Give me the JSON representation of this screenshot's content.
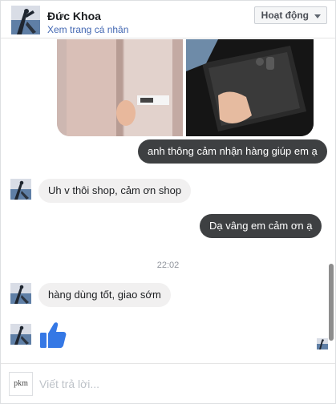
{
  "header": {
    "name": "Đức Khoa",
    "profile_link": "Xem trang cá nhân",
    "status_button": "Hoạt động"
  },
  "messages": {
    "outgoing_1": "anh thông cảm nhận hàng giúp em ạ",
    "incoming_1": "Uh v thôi shop, cảm ơn shop",
    "outgoing_2": "Dạ vâng em cảm ơn ạ",
    "timestamp": "22:02",
    "incoming_2": "hàng dùng tốt, giao sớm"
  },
  "composer": {
    "self_avatar_text": "pkm",
    "placeholder": "Viết trả lời..."
  },
  "icons": {
    "like": "thumbs-up-icon",
    "status_caret": "chevron-down-icon"
  },
  "colors": {
    "outgoing_bubble": "#3e4042",
    "incoming_bubble": "#f1f0f0",
    "link": "#4267b2",
    "like": "#3578e5"
  }
}
